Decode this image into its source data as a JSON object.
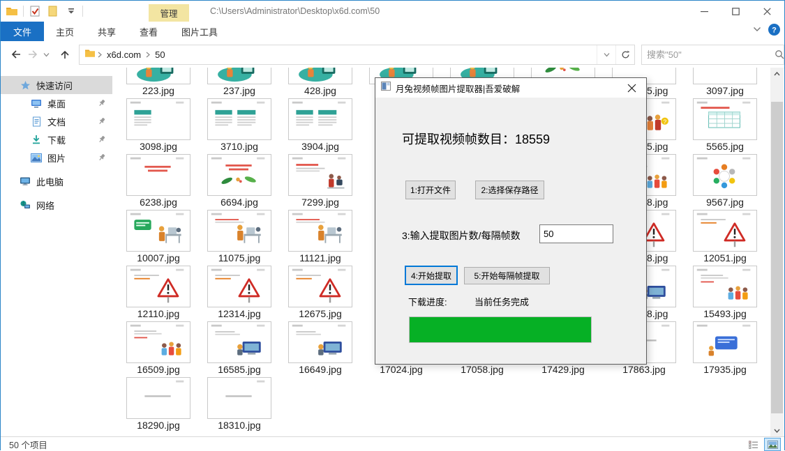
{
  "titlebar": {
    "title": "C:\\Users\\Administrator\\Desktop\\x6d.com\\50",
    "manage_tab_label": "管理",
    "qat_icons": [
      "folder-icon",
      "checked-doc-icon",
      "new-folder-icon",
      "dropdown-icon"
    ],
    "controls": [
      "minimize",
      "maximize",
      "close"
    ]
  },
  "ribbon": {
    "file_tab": "文件",
    "tabs": [
      "主页",
      "共享",
      "查看",
      "图片工具"
    ],
    "icons": [
      "collapse-ribbon-icon",
      "help-icon"
    ]
  },
  "addressbar": {
    "breadcrumb": [
      "x6d.com",
      "50"
    ],
    "icons": [
      "back-icon",
      "forward-icon",
      "chevron-down-icon",
      "up-icon",
      "folder-icon",
      "refresh-icon"
    ],
    "search_placeholder": "搜索\"50\""
  },
  "sidebar": {
    "items": [
      {
        "key": "quick-access",
        "label": "快速访问",
        "icon": "star-icon",
        "level": 0,
        "selected": true,
        "pinned": false
      },
      {
        "key": "desktop",
        "label": "桌面",
        "icon": "desktop-icon",
        "level": 1,
        "selected": false,
        "pinned": true
      },
      {
        "key": "documents",
        "label": "文档",
        "icon": "document-icon",
        "level": 1,
        "selected": false,
        "pinned": true
      },
      {
        "key": "downloads",
        "label": "下载",
        "icon": "download-icon",
        "level": 1,
        "selected": false,
        "pinned": true
      },
      {
        "key": "pictures",
        "label": "图片",
        "icon": "pictures-icon",
        "level": 1,
        "selected": false,
        "pinned": true
      },
      {
        "key": "this-pc",
        "label": "此电脑",
        "icon": "computer-icon",
        "level": 0,
        "selected": false,
        "pinned": false
      },
      {
        "key": "network",
        "label": "网络",
        "icon": "network-icon",
        "level": 0,
        "selected": false,
        "pinned": false
      }
    ]
  },
  "files": {
    "rows": [
      [
        {
          "name": "223.jpg",
          "thumb": "illus"
        },
        {
          "name": "237.jpg",
          "thumb": "illus"
        },
        {
          "name": "428.jpg",
          "thumb": "illus"
        },
        {
          "name": "",
          "thumb": "illus"
        },
        {
          "name": "",
          "thumb": "illus"
        },
        {
          "name": "",
          "thumb": "leaves"
        },
        {
          "name": "5.jpg",
          "thumb": "smallbox",
          "partial": true
        },
        {
          "name": "3097.jpg",
          "thumb": "smallbox"
        }
      ],
      [
        {
          "name": "3098.jpg",
          "thumb": "table1"
        },
        {
          "name": "3710.jpg",
          "thumb": "table2"
        },
        {
          "name": "3904.jpg",
          "thumb": "table2"
        },
        {
          "name": "",
          "thumb": "none"
        },
        {
          "name": "",
          "thumb": "none"
        },
        {
          "name": "",
          "thumb": "none"
        },
        {
          "name": "5.jpg",
          "thumb": "people-q",
          "partial": true
        },
        {
          "name": "5565.jpg",
          "thumb": "calendar"
        }
      ],
      [
        {
          "name": "6238.jpg",
          "thumb": "redtext"
        },
        {
          "name": "6694.jpg",
          "thumb": "leaves"
        },
        {
          "name": "7299.jpg",
          "thumb": "redpeople"
        },
        {
          "name": "",
          "thumb": "none"
        },
        {
          "name": "",
          "thumb": "none"
        },
        {
          "name": "",
          "thumb": "none"
        },
        {
          "name": "8.jpg",
          "thumb": "meeting",
          "partial": true
        },
        {
          "name": "9567.jpg",
          "thumb": "circle"
        }
      ],
      [
        {
          "name": "10007.jpg",
          "thumb": "bubble-desk"
        },
        {
          "name": "11075.jpg",
          "thumb": "desk"
        },
        {
          "name": "11121.jpg",
          "thumb": "desk"
        },
        {
          "name": "",
          "thumb": "none"
        },
        {
          "name": "",
          "thumb": "none"
        },
        {
          "name": "",
          "thumb": "none"
        },
        {
          "name": "8.jpg",
          "thumb": "warning",
          "partial": true
        },
        {
          "name": "12051.jpg",
          "thumb": "warning"
        }
      ],
      [
        {
          "name": "12110.jpg",
          "thumb": "warning"
        },
        {
          "name": "12314.jpg",
          "thumb": "warning"
        },
        {
          "name": "12675.jpg",
          "thumb": "warning"
        },
        {
          "name": "",
          "thumb": "none"
        },
        {
          "name": "",
          "thumb": "none"
        },
        {
          "name": "",
          "thumb": "none"
        },
        {
          "name": "8.jpg",
          "thumb": "computer",
          "partial": true
        },
        {
          "name": "15493.jpg",
          "thumb": "meeting"
        }
      ],
      [
        {
          "name": "16509.jpg",
          "thumb": "meeting"
        },
        {
          "name": "16585.jpg",
          "thumb": "computer"
        },
        {
          "name": "16649.jpg",
          "thumb": "computer"
        },
        {
          "name": "17024.jpg",
          "thumb": "none"
        },
        {
          "name": "17058.jpg",
          "thumb": "none"
        },
        {
          "name": "17429.jpg",
          "thumb": "none"
        },
        {
          "name": "17863.jpg",
          "thumb": "plain"
        },
        {
          "name": "17935.jpg",
          "thumb": "bluebox"
        }
      ],
      [
        {
          "name": "18290.jpg",
          "thumb": "plain"
        },
        {
          "name": "18310.jpg",
          "thumb": "plain"
        },
        {
          "name": "",
          "thumb": "none"
        },
        {
          "name": "",
          "thumb": "none"
        },
        {
          "name": "",
          "thumb": "none"
        },
        {
          "name": "",
          "thumb": "none"
        },
        {
          "name": "",
          "thumb": "none"
        },
        {
          "name": "",
          "thumb": "none"
        }
      ]
    ]
  },
  "dialog": {
    "title": "月兔视频帧图片提取器|吾爱破解",
    "icon": "app-icon",
    "close_icon": "close-icon",
    "frame_count_label": "可提取视频帧数目：18559",
    "btn_open": "1:打开文件",
    "btn_savepath": "2:选择保存路径",
    "input_label": "3:输入提取图片数/每隔帧数",
    "input_value": "50",
    "btn_start": "4:开始提取",
    "btn_start_interval": "5:开始每隔帧提取",
    "progress_label": "下载进度:",
    "progress_status": "当前任务完成",
    "progress_percent": 100,
    "progress_color": "#06b025"
  },
  "statusbar": {
    "items_count": "50 个项目",
    "view_buttons": [
      "details-view-icon",
      "thumbnail-view-icon"
    ]
  },
  "colors": {
    "file_tab_blue": "#1a70c4",
    "manage_tab_yellow": "#f3e5a2",
    "progress_green": "#06b025",
    "focus_blue": "#0078d7",
    "window_border_blue": "#2b85c8"
  }
}
